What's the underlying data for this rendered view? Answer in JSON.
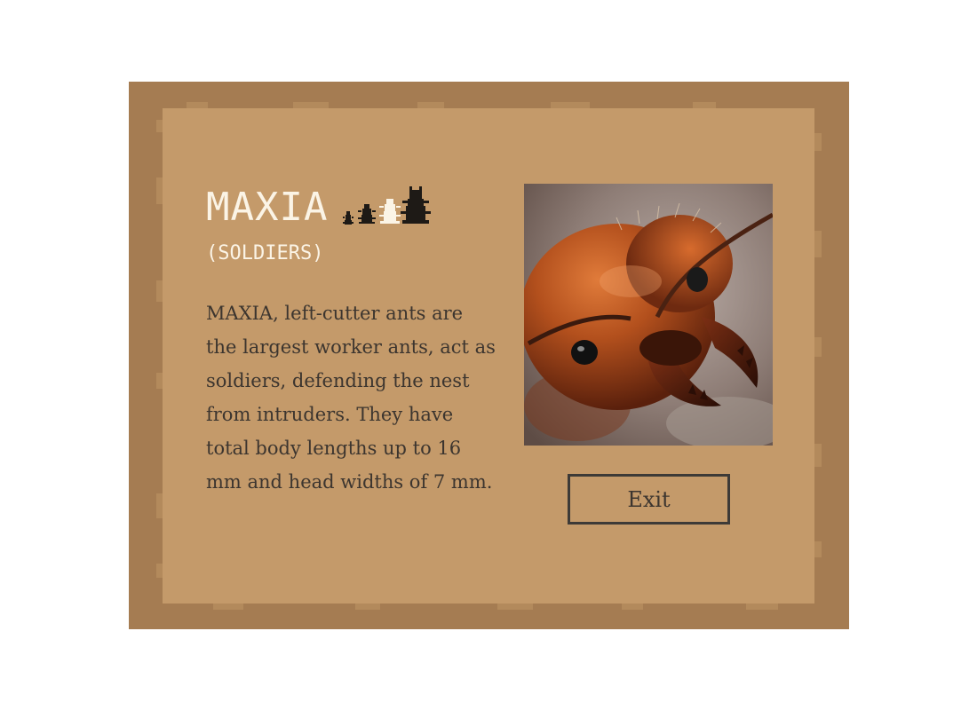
{
  "panel": {
    "title": "MAXIA",
    "subtitle": "(SOLDIERS)",
    "description": "MAXIA, left-cutter ants are the largest worker ants, act as soldiers, defending the nest from intruders. They have total body lengths up to 16 mm and head widths of 7 mm.",
    "caste_icons": [
      "small-ant-icon",
      "medium-ant-icon",
      "large-ant-icon-highlighted",
      "soldier-ant-icon"
    ],
    "photo_subject": "ant-soldier-head-closeup",
    "exit_label": "Exit"
  },
  "colors": {
    "outer_frame": "#a57c52",
    "inner_panel": "#c49a6a",
    "title_text": "#fbf4e6",
    "body_text": "#3c352f",
    "button_border": "#3d3a37"
  }
}
